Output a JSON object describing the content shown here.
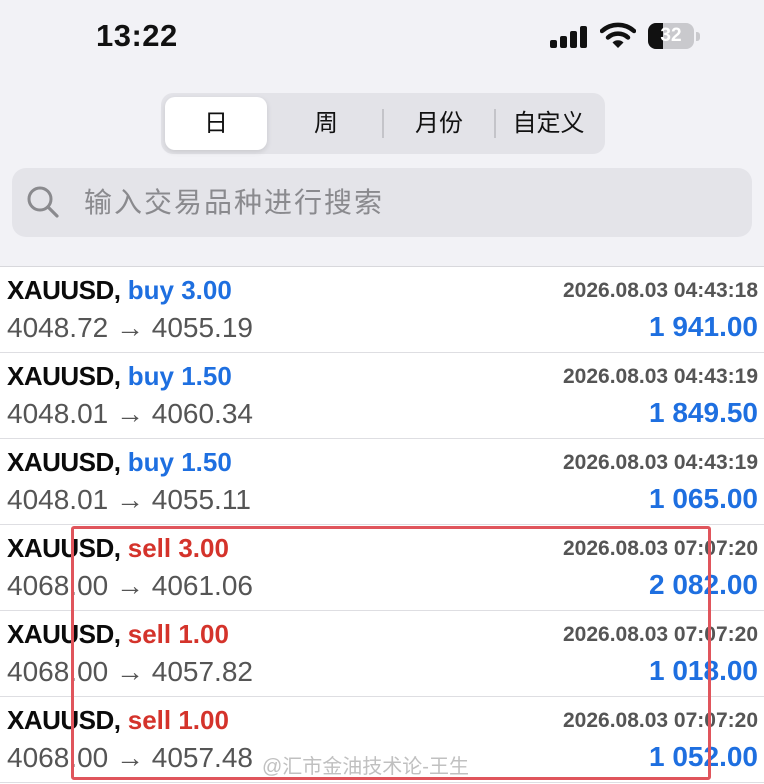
{
  "status_bar": {
    "time": "13:22",
    "battery_percent": "32",
    "battery_level": 0.32
  },
  "period_tabs": {
    "items": [
      {
        "label": "日",
        "active": true
      },
      {
        "label": "周",
        "active": false
      },
      {
        "label": "月份",
        "active": false
      },
      {
        "label": "自定义",
        "active": false
      }
    ]
  },
  "search": {
    "placeholder": "输入交易品种进行搜索",
    "value": ""
  },
  "trades": [
    {
      "symbol": "XAUUSD,",
      "side": "buy",
      "side_label": "buy 3.00",
      "datetime": "2026.08.03 04:43:18",
      "prices": "4048.72 → 4055.19",
      "profit": "1 941.00"
    },
    {
      "symbol": "XAUUSD,",
      "side": "buy",
      "side_label": "buy 1.50",
      "datetime": "2026.08.03 04:43:19",
      "prices": "4048.01 → 4060.34",
      "profit": "1 849.50"
    },
    {
      "symbol": "XAUUSD,",
      "side": "buy",
      "side_label": "buy 1.50",
      "datetime": "2026.08.03 04:43:19",
      "prices": "4048.01 → 4055.11",
      "profit": "1 065.00"
    },
    {
      "symbol": "XAUUSD,",
      "side": "sell",
      "side_label": "sell 3.00",
      "datetime": "2026.08.03 07:07:20",
      "prices": "4068.00 → 4061.06",
      "profit": "2 082.00"
    },
    {
      "symbol": "XAUUSD,",
      "side": "sell",
      "side_label": "sell 1.00",
      "datetime": "2026.08.03 07:07:20",
      "prices": "4068.00 → 4057.82",
      "profit": "1 018.00"
    },
    {
      "symbol": "XAUUSD,",
      "side": "sell",
      "side_label": "sell 1.00",
      "datetime": "2026.08.03 07:07:20",
      "prices": "4068.00 → 4057.48",
      "profit": "1 052.00"
    }
  ],
  "watermark": "@汇市金油技术论-王生",
  "colors": {
    "buy": "#1e6fe0",
    "sell": "#d4332b",
    "profit": "#1e6fe0",
    "highlight": "#e0555c"
  },
  "icons": [
    "signal-icon",
    "wifi-icon",
    "battery-icon",
    "search-icon"
  ]
}
